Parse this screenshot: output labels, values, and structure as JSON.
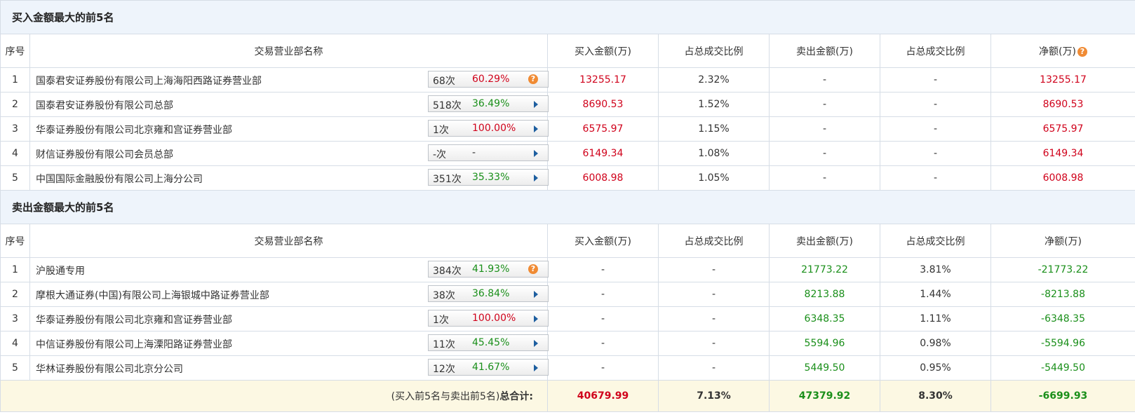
{
  "buy_section": {
    "title": "买入金额最大的前5名",
    "headers": [
      "序号",
      "交易营业部名称",
      "买入金额(万)",
      "占总成交比例",
      "卖出金额(万)",
      "占总成交比例",
      "净额(万)"
    ],
    "rows": [
      {
        "no": "1",
        "name": "国泰君安证券股份有限公司上海海阳西路证券营业部",
        "count": "68次",
        "pct": "60.29%",
        "pct_color": "red",
        "icon": "help-icon",
        "buy": "13255.17",
        "buy_ratio": "2.32%",
        "sell": "-",
        "sell_ratio": "-",
        "net": "13255.17"
      },
      {
        "no": "2",
        "name": "国泰君安证券股份有限公司总部",
        "count": "518次",
        "pct": "36.49%",
        "pct_color": "green",
        "icon": "arrow-right-icon",
        "buy": "8690.53",
        "buy_ratio": "1.52%",
        "sell": "-",
        "sell_ratio": "-",
        "net": "8690.53"
      },
      {
        "no": "3",
        "name": "华泰证券股份有限公司北京雍和宫证券营业部",
        "count": "1次",
        "pct": "100.00%",
        "pct_color": "red",
        "icon": "arrow-right-icon",
        "buy": "6575.97",
        "buy_ratio": "1.15%",
        "sell": "-",
        "sell_ratio": "-",
        "net": "6575.97"
      },
      {
        "no": "4",
        "name": "财信证券股份有限公司会员总部",
        "count": "-次",
        "pct": "-",
        "pct_color": "plain",
        "icon": "arrow-right-icon",
        "buy": "6149.34",
        "buy_ratio": "1.08%",
        "sell": "-",
        "sell_ratio": "-",
        "net": "6149.34"
      },
      {
        "no": "5",
        "name": "中国国际金融股份有限公司上海分公司",
        "count": "351次",
        "pct": "35.33%",
        "pct_color": "green",
        "icon": "arrow-right-icon",
        "buy": "6008.98",
        "buy_ratio": "1.05%",
        "sell": "-",
        "sell_ratio": "-",
        "net": "6008.98"
      }
    ]
  },
  "sell_section": {
    "title": "卖出金额最大的前5名",
    "headers": [
      "序号",
      "交易营业部名称",
      "买入金额(万)",
      "占总成交比例",
      "卖出金额(万)",
      "占总成交比例",
      "净额(万)"
    ],
    "rows": [
      {
        "no": "1",
        "name": "沪股通专用",
        "count": "384次",
        "pct": "41.93%",
        "pct_color": "green",
        "icon": "help-icon",
        "buy": "-",
        "buy_ratio": "-",
        "sell": "21773.22",
        "sell_ratio": "3.81%",
        "net": "-21773.22"
      },
      {
        "no": "2",
        "name": "摩根大通证券(中国)有限公司上海银城中路证券营业部",
        "count": "38次",
        "pct": "36.84%",
        "pct_color": "green",
        "icon": "arrow-right-icon",
        "buy": "-",
        "buy_ratio": "-",
        "sell": "8213.88",
        "sell_ratio": "1.44%",
        "net": "-8213.88"
      },
      {
        "no": "3",
        "name": "华泰证券股份有限公司北京雍和宫证券营业部",
        "count": "1次",
        "pct": "100.00%",
        "pct_color": "red",
        "icon": "arrow-right-icon",
        "buy": "-",
        "buy_ratio": "-",
        "sell": "6348.35",
        "sell_ratio": "1.11%",
        "net": "-6348.35"
      },
      {
        "no": "4",
        "name": "中信证券股份有限公司上海溧阳路证券营业部",
        "count": "11次",
        "pct": "45.45%",
        "pct_color": "green",
        "icon": "arrow-right-icon",
        "buy": "-",
        "buy_ratio": "-",
        "sell": "5594.96",
        "sell_ratio": "0.98%",
        "net": "-5594.96"
      },
      {
        "no": "5",
        "name": "华林证券股份有限公司北京分公司",
        "count": "12次",
        "pct": "41.67%",
        "pct_color": "green",
        "icon": "arrow-right-icon",
        "buy": "-",
        "buy_ratio": "-",
        "sell": "5449.50",
        "sell_ratio": "0.95%",
        "net": "-5449.50"
      }
    ]
  },
  "total": {
    "label_prefix": "(买入前5名与卖出前5名)",
    "label_bold": "总合计:",
    "buy": "40679.99",
    "buy_ratio": "7.13%",
    "sell": "47379.92",
    "sell_ratio": "8.30%",
    "net": "-6699.93"
  },
  "help_glyph": "?",
  "colors": {
    "red": "#d0021b",
    "green": "#1a8f1a",
    "section_bg": "#eef4fb",
    "total_bg": "#fcf8e3",
    "arrow": "#1d5e9f",
    "help": "#f08b34"
  }
}
